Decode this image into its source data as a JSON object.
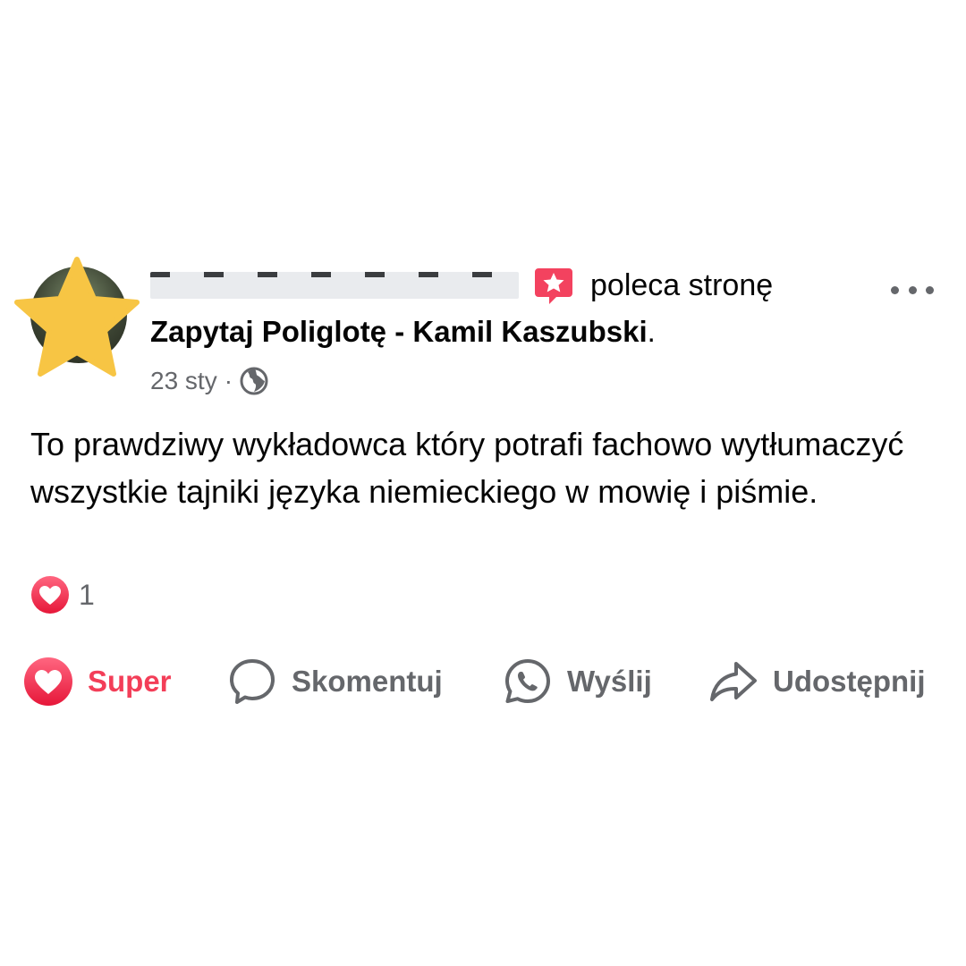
{
  "post": {
    "author": {
      "name_redacted": true,
      "avatar_overlay_icon": "star-icon",
      "avatar_overlay_color": "#f7c544"
    },
    "recommend_icon": "recommend-star-badge-icon",
    "recommend_color": "#f3425f",
    "recommend_text": "poleca stronę",
    "page_name": "Zapytaj Poliglotę - Kamil Kaszubski",
    "page_name_suffix": ".",
    "date": "23 sty",
    "separator": "·",
    "privacy_icon": "globe-icon",
    "text": "To prawdziwy wykładowca który potrafi fachowo wytłumaczyć wszystkie tajniki języka niemieckiego w mowię i piśmie.",
    "reactions": {
      "icon": "love-reaction-icon",
      "count": "1"
    },
    "more_icon": "more-options-icon"
  },
  "actions": [
    {
      "label": "Super",
      "icon": "love-icon",
      "color": "#f33e58"
    },
    {
      "label": "Skomentuj",
      "icon": "comment-icon"
    },
    {
      "label": "Wyślij",
      "icon": "whatsapp-icon"
    },
    {
      "label": "Udostępnij",
      "icon": "share-icon"
    }
  ],
  "colors": {
    "secondary_text": "#65676b",
    "primary_text": "#050505",
    "love": "#f33e58"
  }
}
